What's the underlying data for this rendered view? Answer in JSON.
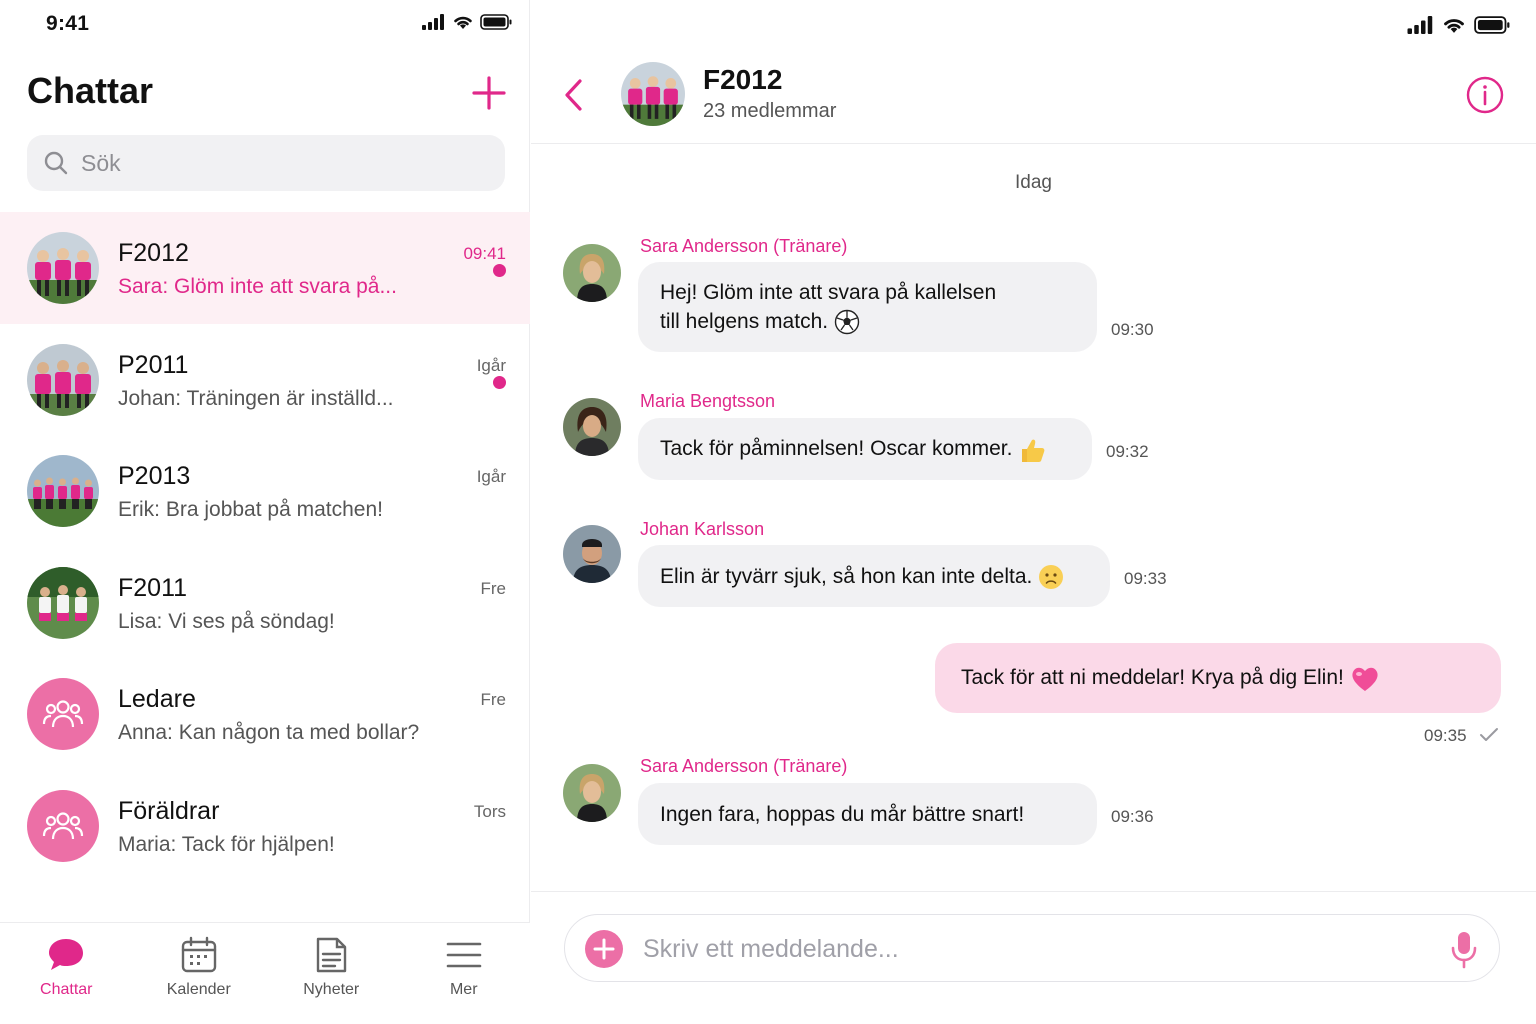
{
  "status": {
    "time": "9:41"
  },
  "sidebar": {
    "title": "Chattar",
    "search_placeholder": "Sök",
    "chats": [
      {
        "name": "F2012",
        "preview": "Sara: Glöm inte att svara på...",
        "time": "09:41",
        "unread": true,
        "active": true
      },
      {
        "name": "P2011",
        "preview": "Johan: Träningen är inställd...",
        "time": "Igår",
        "unread": true,
        "active": false
      },
      {
        "name": "P2013",
        "preview": "Erik: Bra jobbat på matchen!",
        "time": "Igår",
        "unread": false,
        "active": false
      },
      {
        "name": "F2011",
        "preview": "Lisa: Vi ses på söndag!",
        "time": "Fre",
        "unread": false,
        "active": false
      },
      {
        "name": "Ledare",
        "preview": "Anna: Kan någon ta med bollar?",
        "time": "Fre",
        "unread": false,
        "active": false
      },
      {
        "name": "Föräldrar",
        "preview": "Maria: Tack för hjälpen!",
        "time": "Tors",
        "unread": false,
        "active": false
      }
    ]
  },
  "tabbar": {
    "tabs": [
      {
        "label": "Chattar",
        "icon": "chat-bubble-icon",
        "active": true
      },
      {
        "label": "Kalender",
        "icon": "calendar-icon",
        "active": false
      },
      {
        "label": "Nyheter",
        "icon": "news-icon",
        "active": false
      },
      {
        "label": "Mer",
        "icon": "menu-icon",
        "active": false
      }
    ]
  },
  "conversation": {
    "title": "F2012",
    "subtitle": "23 medlemmar",
    "day_label": "Idag",
    "messages": [
      {
        "sender": "Sara Andersson (Tränare)",
        "lines": [
          "Hej! Glöm inte att svara på kallelsen",
          "till helgens match."
        ],
        "emoji": "soccer-ball",
        "time": "09:30",
        "outgoing": false
      },
      {
        "sender": "Maria Bengtsson",
        "lines": [
          "Tack för påminnelsen! Oscar kommer."
        ],
        "emoji": "thumbs-up",
        "time": "09:32",
        "outgoing": false
      },
      {
        "sender": "Johan Karlsson",
        "lines": [
          "Elin är tyvärr sjuk, så hon kan inte delta."
        ],
        "emoji": "sad-face",
        "time": "09:33",
        "outgoing": false
      },
      {
        "sender": "",
        "lines": [
          "Tack för att ni meddelar! Krya på dig Elin!"
        ],
        "emoji": "pink-heart",
        "time": "09:35",
        "outgoing": true
      },
      {
        "sender": "Sara Andersson (Tränare)",
        "lines": [
          "Ingen fara, hoppas du mår bättre snart!"
        ],
        "emoji": "",
        "time": "09:36",
        "outgoing": false
      }
    ],
    "composer_placeholder": "Skriv ett meddelande..."
  },
  "colors": {
    "accent": "#e0288a",
    "accent_soft": "#ec6fa6",
    "outgoing_bubble": "#fbd9e8",
    "incoming_bubble": "#f1f1f3"
  }
}
